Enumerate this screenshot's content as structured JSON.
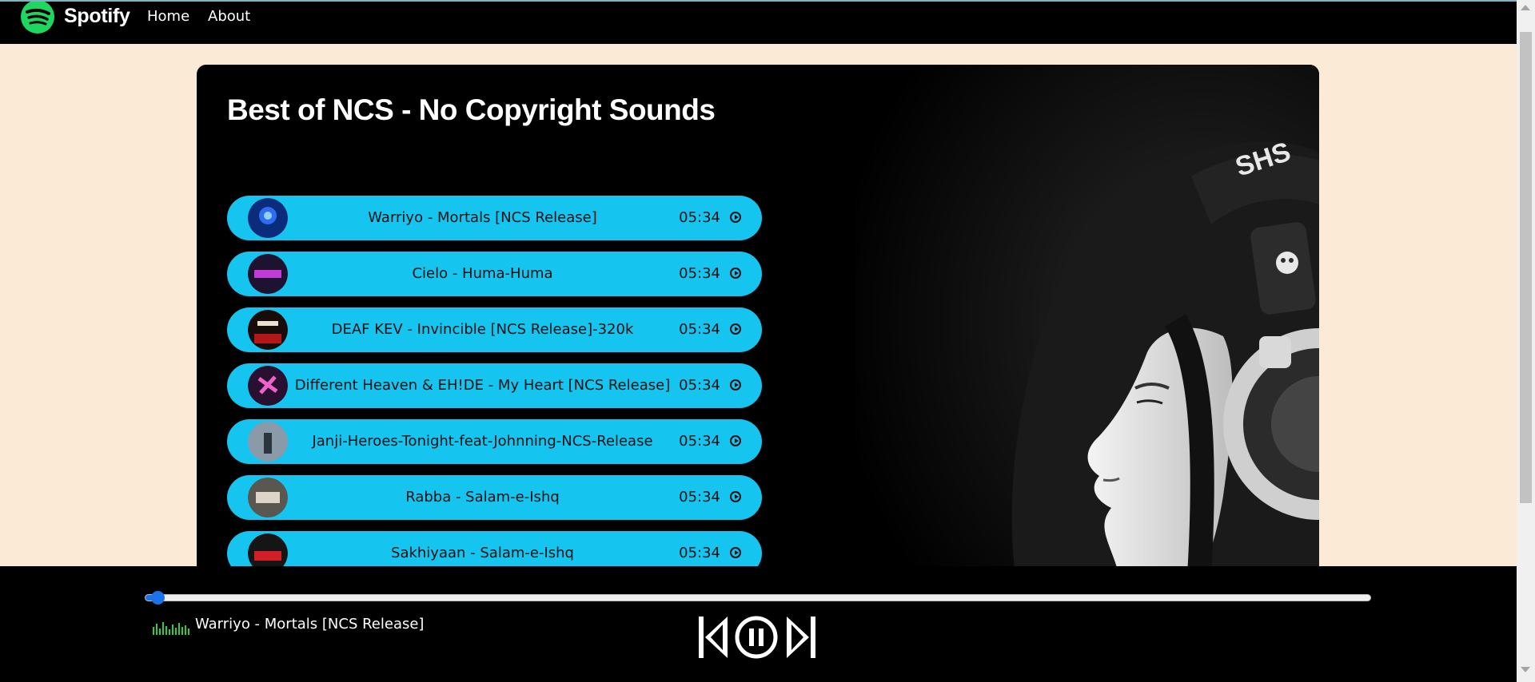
{
  "nav": {
    "brand": "Spotify",
    "links": [
      "Home",
      "About"
    ]
  },
  "card": {
    "title": "Best of NCS - No Copyright Sounds"
  },
  "songs": [
    {
      "name": "Warriyo - Mortals [NCS Release]",
      "duration": "05:34"
    },
    {
      "name": "Cielo - Huma-Huma",
      "duration": "05:34"
    },
    {
      "name": "DEAF KEV - Invincible [NCS Release]-320k",
      "duration": "05:34"
    },
    {
      "name": "Different Heaven & EH!DE - My Heart [NCS Release]",
      "duration": "05:34"
    },
    {
      "name": "Janji-Heroes-Tonight-feat-Johnning-NCS-Release",
      "duration": "05:34"
    },
    {
      "name": "Rabba - Salam-e-Ishq",
      "duration": "05:34"
    },
    {
      "name": "Sakhiyaan - Salam-e-Ishq",
      "duration": "05:34"
    }
  ],
  "player": {
    "now_playing": "Warriyo - Mortals [NCS Release]",
    "progress": 0.01,
    "state": "playing"
  },
  "colors": {
    "page_bg": "#fbead6",
    "accent": "#15c5f0",
    "brand_green": "#1ed760",
    "progress": "#1a73e8"
  },
  "icons": [
    "spotify-logo-icon",
    "play-circle-icon",
    "previous-icon",
    "pause-circle-icon",
    "next-icon",
    "equalizer-icon"
  ]
}
